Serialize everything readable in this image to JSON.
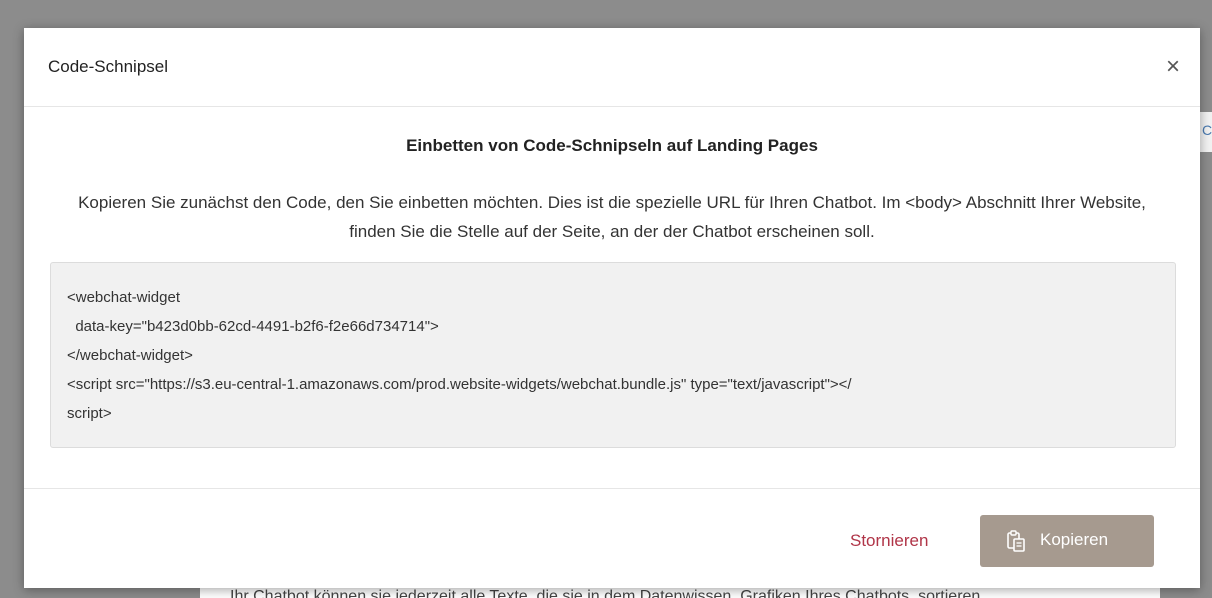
{
  "modal": {
    "title": "Code-Schnipsel",
    "close_icon": "×",
    "heading": "Einbetten von Code-Schnipseln auf Landing Pages",
    "description": "Kopieren Sie zunächst den Code, den Sie einbetten möchten. Dies ist die spezielle URL für Ihren Chatbot. Im <body> Abschnitt Ihrer Website, finden Sie die Stelle auf der Seite, an der der Chatbot erscheinen soll.",
    "code_lines": [
      "<webchat-widget",
      "  data-key=\"b423d0bb-62cd-4491-b2f6-f2e66d734714\">",
      "</webchat-widget>",
      "<script src=\"https://s3.eu-central-1.amazonaws.com/prod.website-widgets/webchat.bundle.js\" type=\"text/javascript\"></",
      "script>"
    ],
    "cancel_label": "Stornieren",
    "copy_label": "Kopieren",
    "copy_icon": "clipboard-icon"
  },
  "background": {
    "peek_right_text": "C",
    "bottom_text": "Ihr Chatbot können sie jederzeit alle Texte, die sie in dem Datenwissen, Grafiken Ihres Chatbots, sortieren"
  },
  "colors": {
    "accent_cancel": "#b03548",
    "copy_button": "#a69a8f",
    "code_background": "#f1f1f1"
  }
}
